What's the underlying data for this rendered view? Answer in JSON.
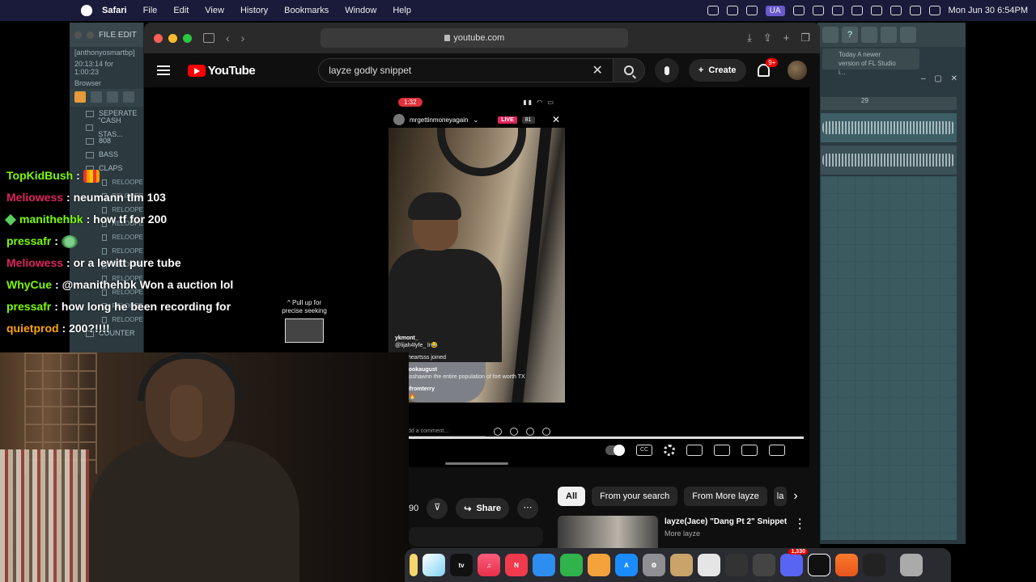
{
  "menubar": {
    "app": "Safari",
    "items": [
      "File",
      "Edit",
      "View",
      "History",
      "Bookmarks",
      "Window",
      "Help"
    ],
    "badge": "UA",
    "datetime": "Mon Jun 30  6:54PM"
  },
  "fl_left": {
    "title": "FILE EDIT",
    "project": "[anthonyosmartbp]",
    "time": "20:13:14 for 1:00:23",
    "browser_label": "Browser",
    "folders": [
      "SEPERATE",
      "\"CASH STAS...",
      "808",
      "BASS",
      "CLAPS"
    ],
    "clips": [
      "RELOOPE",
      "RELOOPE",
      "RELOOPE",
      "RELOOPE",
      "RELOOPE",
      "RELOOPE",
      "RELOOPE",
      "RELOOPE",
      "RELOOPE",
      "RELOOPE",
      "RELOOPE"
    ],
    "last_folder": "COUNTER"
  },
  "fl_right": {
    "news": "Today  A newer version of FL Studio i...",
    "timeline_marker": "29"
  },
  "safari": {
    "url": "youtube.com"
  },
  "youtube": {
    "logo": "YouTube",
    "search_value": "layze godly snippet",
    "create_label": "Create",
    "notif_badge": "9+",
    "share_label": "Share",
    "count": "90",
    "chips": [
      "All",
      "From your search",
      "From More layze",
      "la"
    ],
    "rec": {
      "title": "layze(Jace) \"Dang Pt 2\" Snippet",
      "channel": "More layze"
    },
    "pull_up": "^ Pull up for precise seeking"
  },
  "phone": {
    "time": "1:32",
    "username": "mrgettinmoneyagain",
    "live": "LIVE",
    "viewers": "81",
    "comments": [
      {
        "user": "ykmont_",
        "text": "@lijah4lyfe_ lr😂"
      },
      {
        "user": "",
        "text": "woccheartsss joined"
      },
      {
        "user": "theytookaugust",
        "text": "@dsssshawnn the entire population of fort worth TX"
      },
      {
        "user": "kinzofromterry",
        "text": "🔥🔥🔥"
      }
    ],
    "comment_placeholder": "dd a comment..."
  },
  "chat": [
    {
      "user": "TopKidBush",
      "color": "#7CFC00",
      "text": "",
      "emote": "bars"
    },
    {
      "user": "Meliowess",
      "color": "#E0245E",
      "text": "neumann tlm 103"
    },
    {
      "user": "manithehbk",
      "color": "#7CFC00",
      "text": "how tf for 200",
      "badge": true
    },
    {
      "user": "pressafr",
      "color": "#7CFC00",
      "text": "",
      "emote": "frog"
    },
    {
      "user": "Meliowess",
      "color": "#E0245E",
      "text": "or a lewitt pure tube"
    },
    {
      "user": "WhyCue",
      "color": "#7CFC00",
      "text": "@manithehbk Won a auction lol"
    },
    {
      "user": "pressafr",
      "color": "#7CFC00",
      "text": "how long he been recording for"
    },
    {
      "user": "quietprod",
      "color": "#FFA500",
      "text": "200?!!!!"
    }
  ],
  "dock": {
    "tv_label": "tv",
    "apps": [
      "finder-icon",
      "freeform-icon",
      "appletv-icon",
      "music-icon",
      "news-icon",
      "keynote-icon",
      "numbers-icon",
      "pages-icon",
      "appstore-icon",
      "settings-icon",
      "archive-icon",
      "roblox-icon",
      "controller-icon",
      "steering-icon",
      "discord-icon",
      "capcut-icon",
      "flstudio-icon",
      "activity-icon",
      "trash-icon"
    ],
    "discord_badge": "1,330"
  }
}
